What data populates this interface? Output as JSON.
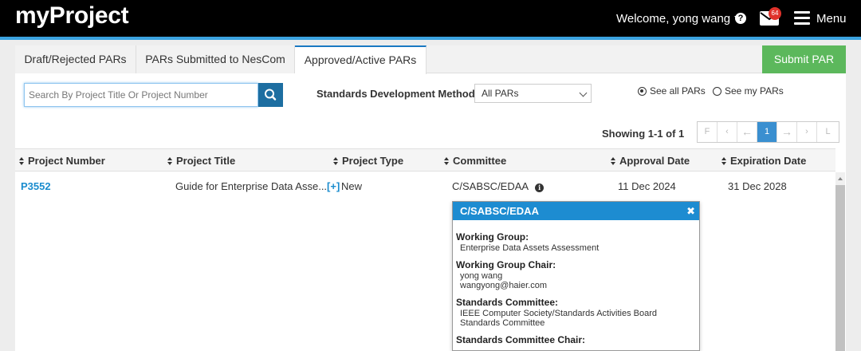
{
  "header": {
    "logo": "myProject",
    "welcome": "Welcome, yong wang",
    "help_icon": "question-circle-icon",
    "mail_badge": "64",
    "menu_label": "Menu",
    "accent_color": "#3ba3e0"
  },
  "tabs": [
    {
      "label": "Draft/Rejected PARs",
      "active": false
    },
    {
      "label": "PARs Submitted to NesCom",
      "active": false
    },
    {
      "label": "Approved/Active PARs",
      "active": true
    }
  ],
  "submit_label": "Submit PAR",
  "search": {
    "placeholder": "Search By Project Title Or Project Number",
    "value": ""
  },
  "filter": {
    "label": "Standards Development Method:",
    "selected": "All PARs",
    "radio_all": "See all PARs",
    "radio_mine": "See my PARs",
    "selected_radio": "all"
  },
  "paging": {
    "showing": "Showing 1-1 of 1",
    "first": "F",
    "prev": "‹",
    "prev_arrow": "←",
    "page": "1",
    "next_arrow": "→",
    "next": "›",
    "last": "L"
  },
  "table": {
    "columns": [
      "Project Number",
      "Project Title",
      "Project Type",
      "Committee",
      "Approval Date",
      "Expiration Date"
    ],
    "rows": [
      {
        "number": "P3552",
        "title": "Guide for Enterprise Data Asse...",
        "expand": "[+]",
        "type": "New",
        "committee": "C/SABSC/EDAA",
        "approval": "11 Dec 2024",
        "expiration": "31 Dec 2028"
      }
    ]
  },
  "popover": {
    "title": "C/SABSC/EDAA",
    "wg_label": "Working Group:",
    "wg_value": "Enterprise Data Assets Assessment",
    "wgc_label": "Working Group Chair:",
    "wgc_name": "yong wang",
    "wgc_email": "wangyong@haier.com",
    "sc_label": "Standards Committee:",
    "sc_value": "IEEE Computer Society/Standards Activities Board Standards Committee",
    "scc_label": "Standards Committee Chair:"
  }
}
